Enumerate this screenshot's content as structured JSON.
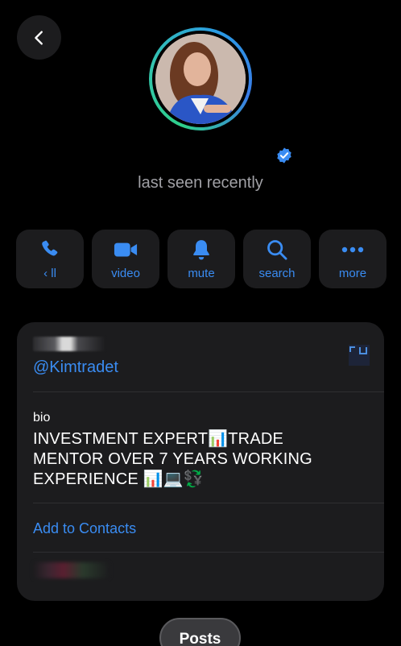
{
  "header": {
    "back_icon": "chevron-left-icon"
  },
  "profile": {
    "status": "last seen recently",
    "verified_color": "#3a8cf2"
  },
  "actions": [
    {
      "icon": "phone-icon",
      "label": "‹ ll"
    },
    {
      "icon": "video-camera-icon",
      "label": "video"
    },
    {
      "icon": "bell-icon",
      "label": "mute"
    },
    {
      "icon": "search-icon",
      "label": "search"
    },
    {
      "icon": "more-icon",
      "label": "more"
    }
  ],
  "info": {
    "username": "@Kimtradet",
    "bio_label": "bio",
    "bio_line1": "INVESTMENT EXPERT",
    "bio_emoji1": "📊",
    "bio_line1b": "TRADE",
    "bio_line2": "MENTOR OVER 7 YEARS WORKING",
    "bio_line3": "EXPERIENCE",
    "bio_emoji3": "📊💻💱",
    "add_contacts": "Add to Contacts"
  },
  "tabs": {
    "posts": "Posts"
  },
  "colors": {
    "accent": "#3a8cf2",
    "background": "#000000",
    "card": "#1c1c1e"
  }
}
